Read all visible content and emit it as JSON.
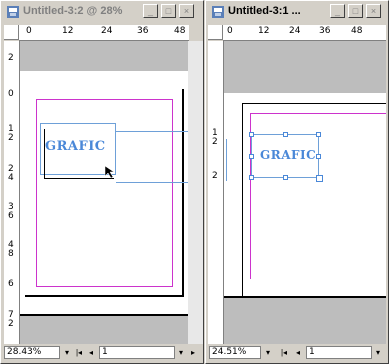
{
  "left_window": {
    "title": "Untitled-3:2 @ 28%",
    "ruler_h": [
      "0",
      "12",
      "24",
      "36",
      "48"
    ],
    "ruler_v": [
      "2",
      "0",
      "1\n2",
      "2\n4",
      "3\n6",
      "4\n8",
      "6",
      "7\n2"
    ],
    "graphic_text": "GRAFIC",
    "zoom": "28.43%",
    "page": "1"
  },
  "right_window": {
    "title": "Untitled-3:1 ...",
    "ruler_h": [
      "0",
      "12",
      "24",
      "36",
      "48"
    ],
    "ruler_v": [
      "1\n2",
      "2"
    ],
    "graphic_text": "GRAFIC",
    "zoom": "24.51%",
    "page": "1"
  },
  "colors": {
    "margin": "#cc33cc",
    "frame": "#6ea0d8",
    "graphic": "#4a88d8",
    "pasteboard": "#bdbdbd"
  }
}
